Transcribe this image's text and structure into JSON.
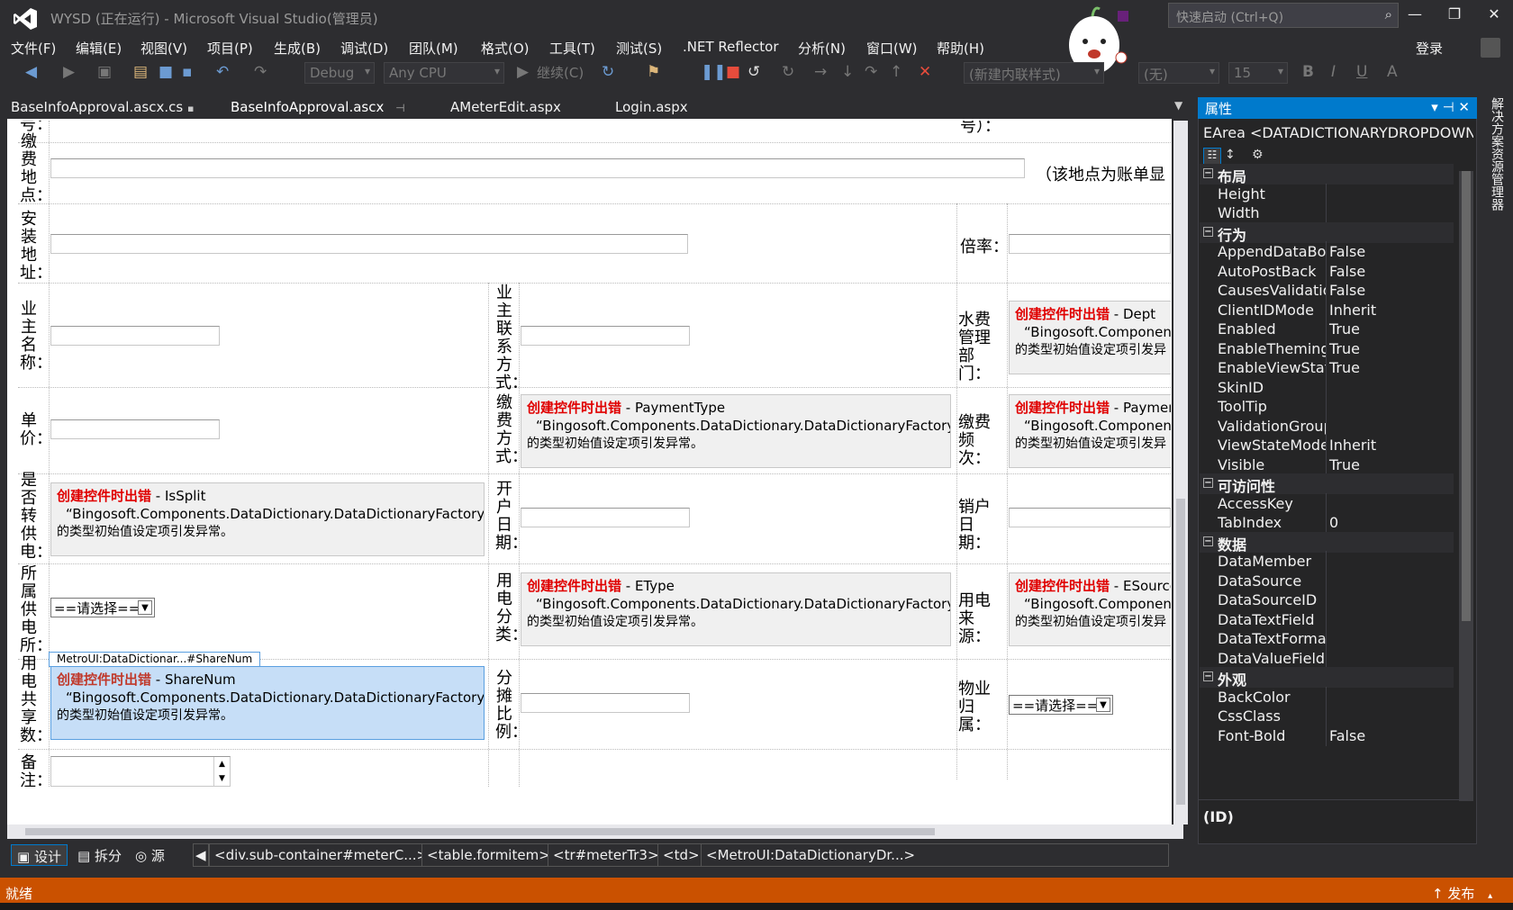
{
  "window": {
    "title": "WYSD (正在运行) - Microsoft Visual Studio(管理员)",
    "quick_launch_placeholder": "快速启动 (Ctrl+Q)",
    "login": "登录"
  },
  "menu": [
    "文件(F)",
    "编辑(E)",
    "视图(V)",
    "项目(P)",
    "生成(B)",
    "调试(D)",
    "团队(M)",
    "格式(O)",
    "工具(T)",
    "测试(S)",
    ".NET Reflector",
    "分析(N)",
    "窗口(W)",
    "帮助(H)"
  ],
  "toolbar": {
    "config": "Debug",
    "platform": "Any CPU",
    "continue": "继续(C)",
    "style_combo": "(新建内联样式)",
    "font_combo": "(无)",
    "size_combo": "15"
  },
  "tabs": [
    "BaseInfoApproval.ascx.cs",
    "BaseInfoApproval.ascx",
    "AMeterEdit.aspx",
    "Login.aspx"
  ],
  "designer": {
    "label_hao_top_left": "号：",
    "label_hao_top_right": "号）：",
    "pay_place": "缴费地点：",
    "pay_place_note": "（该地点为账单显",
    "install_addr": "安装地址：",
    "rate": "倍率：",
    "owner_name": "业主名称：",
    "owner_contact": "业主联系方式：",
    "water_dept": "水费管理部门：",
    "unit_price": "单价：",
    "pay_method": "缴费方式：",
    "pay_freq": "缴费频次：",
    "is_split": "是否转供电：",
    "open_date": "开户日期：",
    "close_date": "销户日期：",
    "supply_station": "所属供电所：",
    "elec_class": "用电分类：",
    "elec_source": "用电来源：",
    "share_num": "用电共享数：",
    "share_ratio": "分摊比例：",
    "property": "物业归属：",
    "remark": "备注：",
    "select_default": "==请选择==",
    "err_title": "创建控件时出错",
    "err_msg": "“Bingosoft.Components.DataDictionary.DataDictionaryFactory”",
    "err_msg_cut": "“Bingosoft.Component",
    "err_tail": "的类型初始值设定项引发异常。",
    "err_tail_cut": "的类型初始值设定项引发异",
    "ctrl_dept": "Dept",
    "ctrl_paymenttype": "PaymentType",
    "ctrl_paymen": "Paymen",
    "ctrl_issplit": "IsSplit",
    "ctrl_etype": "EType",
    "ctrl_esource": "ESource",
    "ctrl_sharenum": "ShareNum",
    "selected_tag": "MetroUI:DataDictionar...#ShareNum"
  },
  "views": [
    "设计",
    "拆分",
    "源"
  ],
  "breadcrumb": [
    "<div.sub-container#meterC...>",
    "<table.formitem>",
    "<tr#meterTr3>",
    "<td>",
    "<MetroUI:DataDictionaryDr...>"
  ],
  "properties": {
    "header": "属性",
    "object": "EArea <DATADICTIONARYDROPDOWN",
    "categories": [
      {
        "name": "布局",
        "rows": [
          [
            "Height",
            ""
          ],
          [
            "Width",
            ""
          ]
        ]
      },
      {
        "name": "行为",
        "rows": [
          [
            "AppendDataBou",
            "False"
          ],
          [
            "AutoPostBack",
            "False"
          ],
          [
            "CausesValidatior",
            "False"
          ],
          [
            "ClientIDMode",
            "Inherit"
          ],
          [
            "Enabled",
            "True"
          ],
          [
            "EnableTheming",
            "True"
          ],
          [
            "EnableViewState",
            "True"
          ],
          [
            "SkinID",
            ""
          ],
          [
            "ToolTip",
            ""
          ],
          [
            "ValidationGroup",
            ""
          ],
          [
            "ViewStateMode",
            "Inherit"
          ],
          [
            "Visible",
            "True"
          ]
        ]
      },
      {
        "name": "可访问性",
        "rows": [
          [
            "AccessKey",
            ""
          ],
          [
            "TabIndex",
            "0"
          ]
        ]
      },
      {
        "name": "数据",
        "rows": [
          [
            "DataMember",
            ""
          ],
          [
            "DataSource",
            ""
          ],
          [
            "DataSourceID",
            ""
          ],
          [
            "DataTextField",
            ""
          ],
          [
            "DataTextFormat",
            ""
          ],
          [
            "DataValueField",
            ""
          ]
        ]
      },
      {
        "name": "外观",
        "rows": [
          [
            "BackColor",
            ""
          ],
          [
            "CssClass",
            ""
          ],
          [
            "Font-Bold",
            "False"
          ]
        ]
      }
    ],
    "selected_desc": "(ID)"
  },
  "side_tab": "解决方案资源管理器",
  "status": {
    "text": "就绪",
    "publish": "发布"
  },
  "colors": {
    "accent": "#007acc",
    "status": "#ca5100",
    "error": "#e00000"
  }
}
